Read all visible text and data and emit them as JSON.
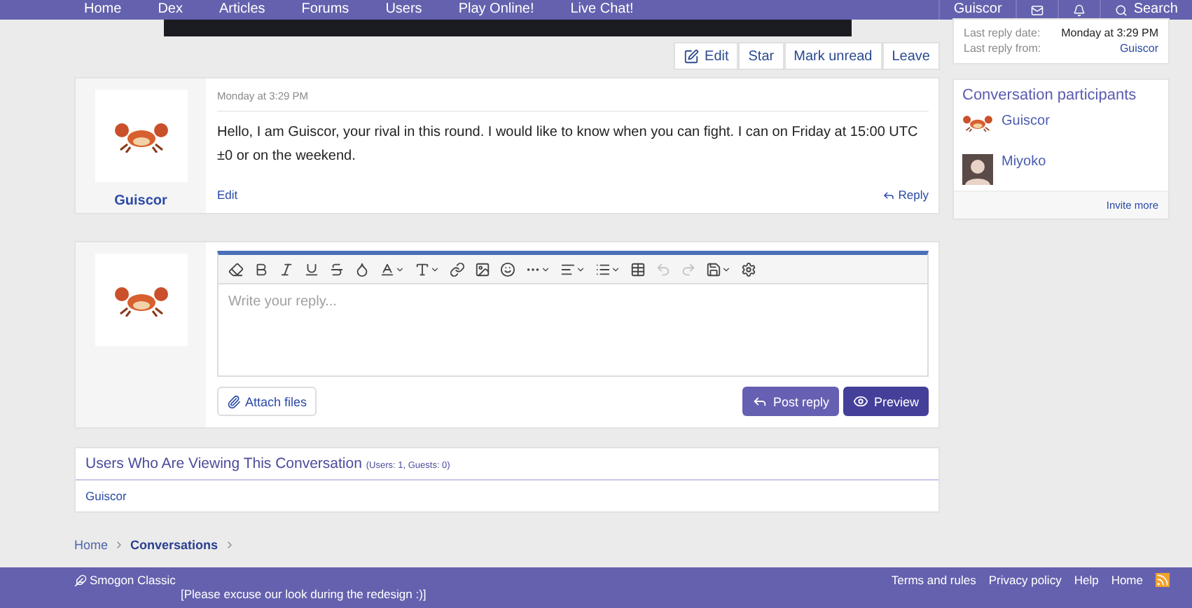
{
  "nav": {
    "items": [
      {
        "label": "Home"
      },
      {
        "label": "Dex"
      },
      {
        "label": "Articles"
      },
      {
        "label": "Forums"
      },
      {
        "label": "Users"
      },
      {
        "label": "Play Online!"
      },
      {
        "label": "Live Chat!"
      }
    ],
    "user": "Guiscor",
    "search": "Search"
  },
  "actions": [
    "Edit",
    "Star",
    "Mark unread",
    "Leave"
  ],
  "message": {
    "date": "Monday at 3:29 PM",
    "author": "Guiscor",
    "text": "Hello, I am Guiscor, your rival in this round. I would like to know when you can fight. I can on Friday at 15:00 UTC ±0 or on the weekend.",
    "edit": "Edit",
    "reply": "Reply"
  },
  "editor": {
    "placeholder": "Write your reply...",
    "tools": [
      {
        "kind": "eraser",
        "disabled": false
      },
      {
        "kind": "bold",
        "disabled": false
      },
      {
        "kind": "italic",
        "disabled": false
      },
      {
        "kind": "underline",
        "disabled": false
      },
      {
        "kind": "strike",
        "disabled": false
      },
      {
        "kind": "color",
        "disabled": false
      },
      {
        "kind": "font",
        "disabled": false
      },
      {
        "kind": "size",
        "disabled": false
      },
      {
        "kind": "link",
        "disabled": false
      },
      {
        "kind": "image",
        "disabled": false
      },
      {
        "kind": "smile",
        "disabled": false
      },
      {
        "kind": "more",
        "disabled": false
      },
      {
        "kind": "align",
        "disabled": false
      },
      {
        "kind": "list",
        "disabled": false
      },
      {
        "kind": "table",
        "disabled": false
      },
      {
        "kind": "undo",
        "disabled": true
      },
      {
        "kind": "redo",
        "disabled": true
      },
      {
        "kind": "drafts",
        "disabled": false
      },
      {
        "kind": "settings",
        "disabled": false
      }
    ],
    "attach": "Attach files",
    "post": "Post reply",
    "preview": "Preview"
  },
  "viewing": {
    "title": "Users Who Are Viewing This Conversation",
    "counts": "(Users: 1, Guests: 0)",
    "users": [
      "Guiscor"
    ]
  },
  "breadcrumb": [
    {
      "label": "Home",
      "current": false
    },
    {
      "label": "Conversations",
      "current": true
    }
  ],
  "sidebar": {
    "info": [
      {
        "label": "Last reply date:",
        "value": "Monday at 3:29 PM",
        "link": false
      },
      {
        "label": "Last reply from:",
        "value": "Guiscor",
        "link": true
      }
    ],
    "participants_title": "Conversation participants",
    "participants": [
      {
        "name": "Guiscor",
        "kind": "crab"
      },
      {
        "name": "Miyoko",
        "kind": "person"
      }
    ],
    "invite": "Invite more"
  },
  "footer": {
    "brand": "Smogon Classic",
    "note": "[Please excuse our look during the redesign :)]",
    "links": [
      "Terms and rules",
      "Privacy policy",
      "Help",
      "Home"
    ]
  }
}
